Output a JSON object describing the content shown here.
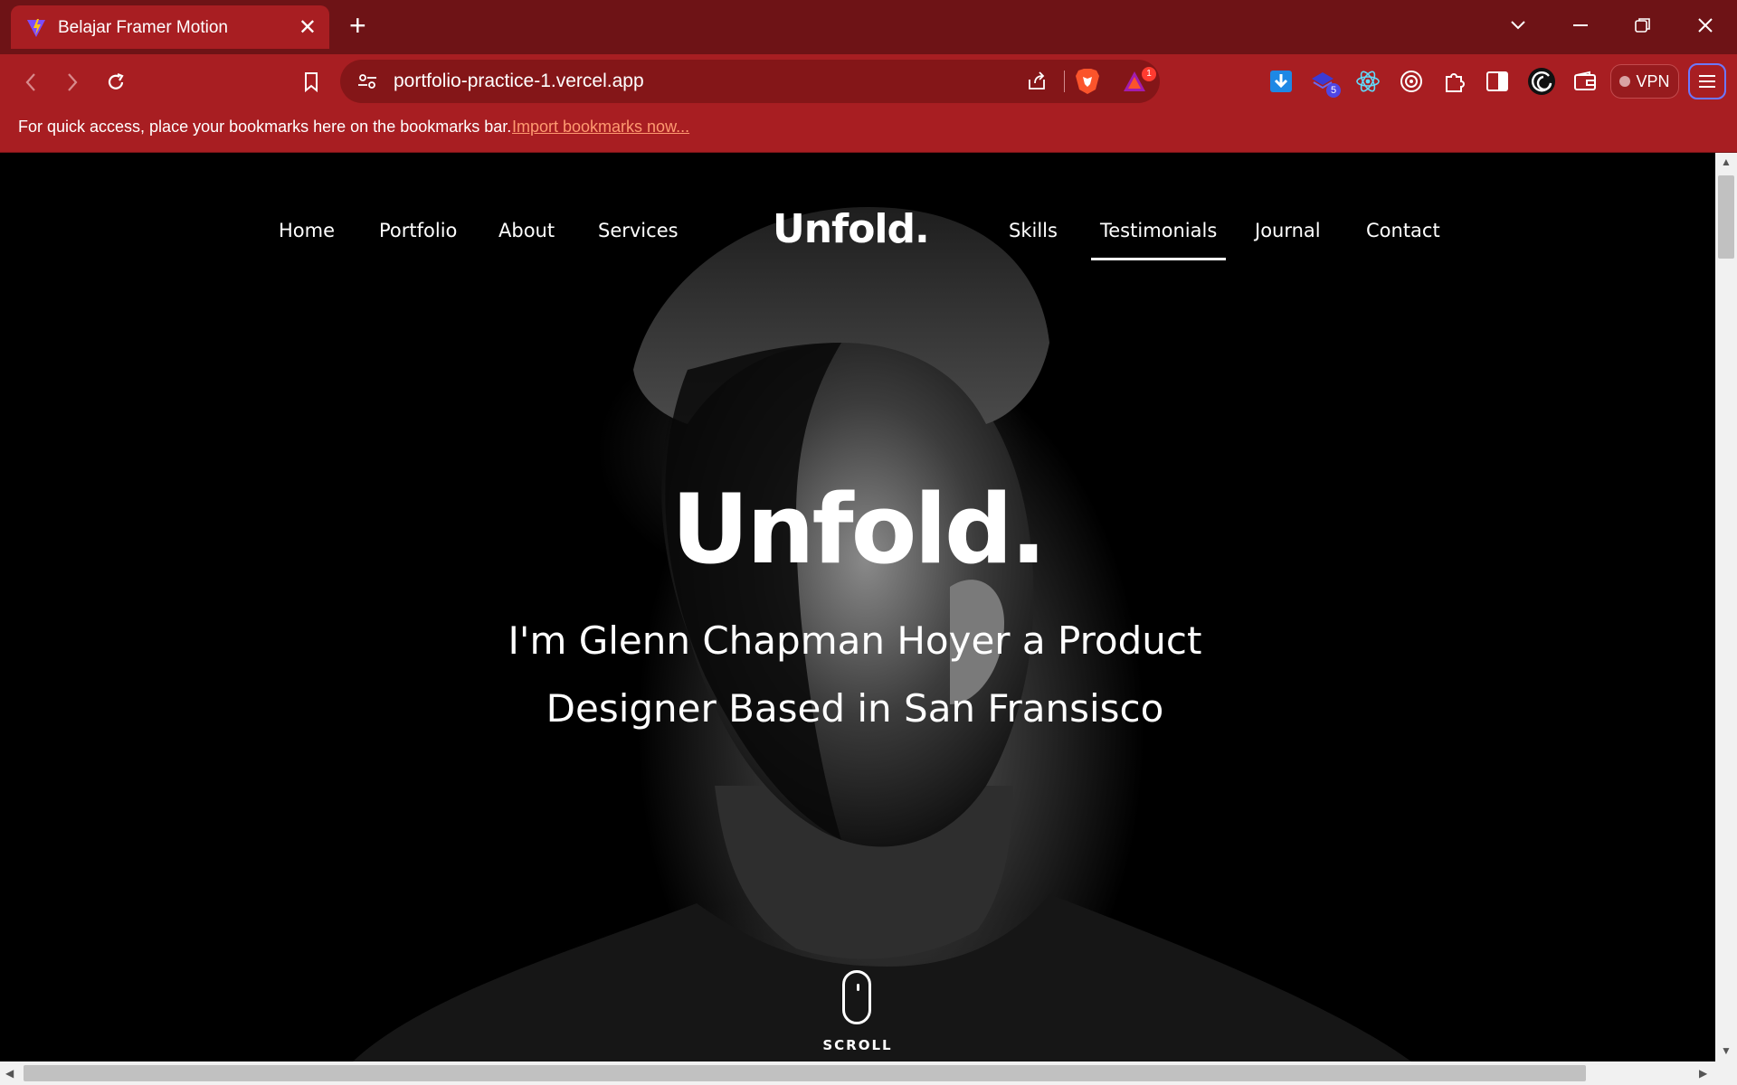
{
  "browser": {
    "tab": {
      "title": "Belajar Framer Motion"
    },
    "url": "portfolio-practice-1.vercel.app",
    "rewards_badge": "1",
    "extension_badge": "5",
    "vpn_label": "VPN",
    "bookmarks_bar": {
      "message": "For quick access, place your bookmarks here on the bookmarks bar.",
      "import_link": "Import bookmarks now..."
    },
    "colors": {
      "chrome_red": "#a81e22",
      "tabbar_dark": "#6e1316"
    }
  },
  "page": {
    "nav_left": [
      "Home",
      "Portfolio",
      "About",
      "Services"
    ],
    "logo": "Unfold.",
    "nav_right": [
      "Skills",
      "Testimonials",
      "Journal",
      "Contact"
    ],
    "active_nav": "Testimonials",
    "hero": {
      "title": "Unfold.",
      "subtitle_line1": "I'm Glenn Chapman Hoyer a Product",
      "subtitle_line2": "Designer Based in San Fransisco"
    },
    "scroll_label": "SCROLL"
  }
}
